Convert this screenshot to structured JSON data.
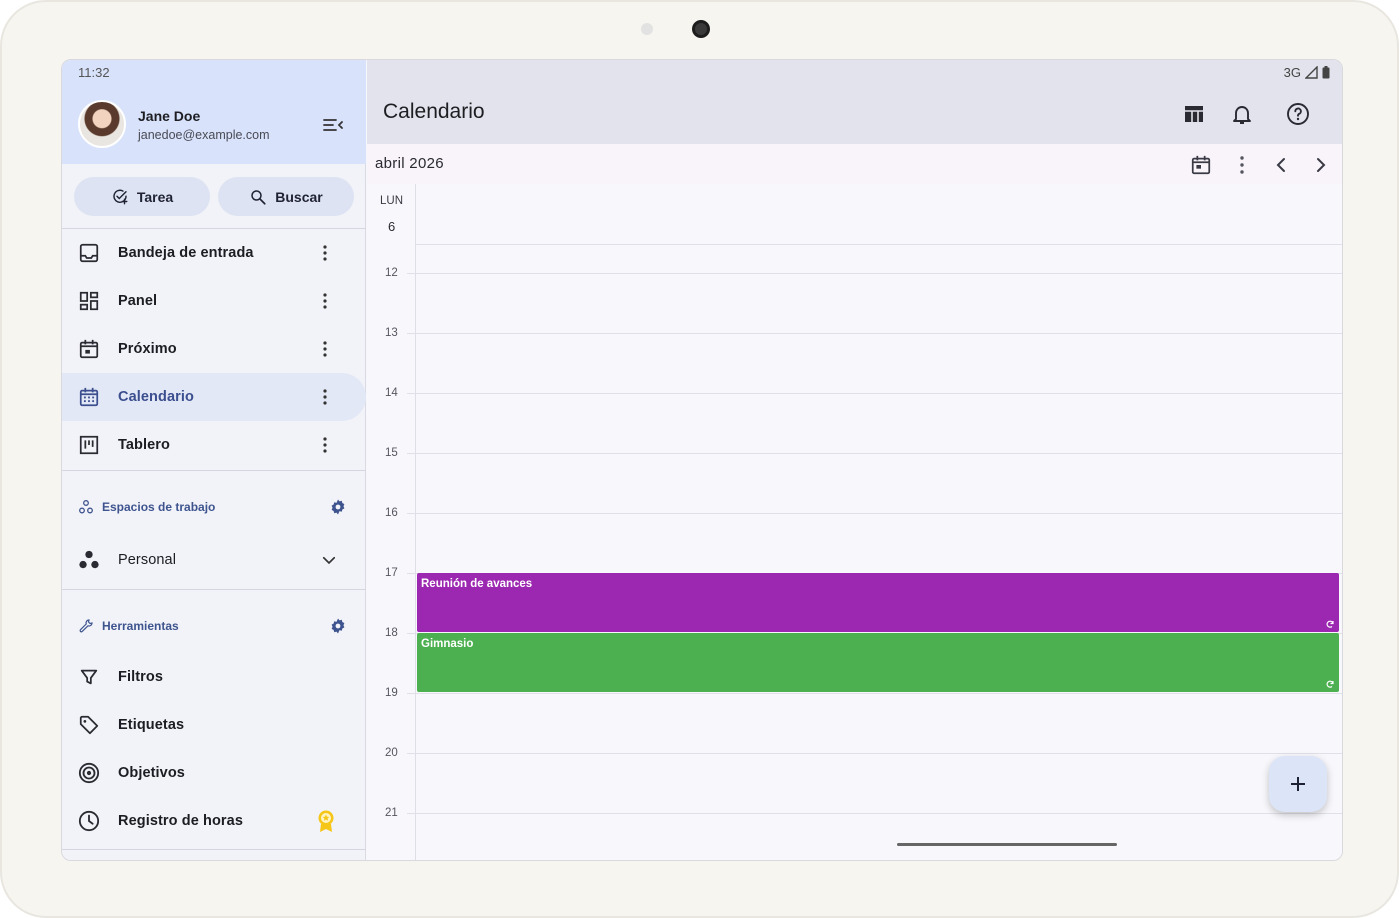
{
  "status": {
    "time": "11:32",
    "network": "3G"
  },
  "user": {
    "name": "Jane Doe",
    "email": "janedoe@example.com"
  },
  "actions": {
    "task_label": "Tarea",
    "search_label": "Buscar"
  },
  "nav": [
    {
      "label": "Bandeja de entrada",
      "icon": "inbox-icon"
    },
    {
      "label": "Panel",
      "icon": "dashboard-icon"
    },
    {
      "label": "Próximo",
      "icon": "upcoming-icon"
    },
    {
      "label": "Calendario",
      "icon": "calendar-icon",
      "active": true
    },
    {
      "label": "Tablero",
      "icon": "board-icon"
    }
  ],
  "workspaces": {
    "header": "Espacios de trabajo",
    "items": [
      {
        "label": "Personal"
      }
    ]
  },
  "tools": {
    "header": "Herramientas",
    "items": [
      {
        "label": "Filtros",
        "icon": "filter-icon"
      },
      {
        "label": "Etiquetas",
        "icon": "tag-icon"
      },
      {
        "label": "Objetivos",
        "icon": "target-icon"
      },
      {
        "label": "Registro de horas",
        "icon": "clock-icon",
        "badge": "premium-badge-icon"
      }
    ]
  },
  "main": {
    "title": "Calendario",
    "month": "abril 2026",
    "day_name": "LUN",
    "day_number": "6",
    "hours": [
      "12",
      "13",
      "14",
      "15",
      "16",
      "17",
      "18",
      "19",
      "20",
      "21"
    ],
    "events": [
      {
        "title": "Reunión de avances",
        "color": "#9c27b0",
        "start_hour": "17"
      },
      {
        "title": "Gimnasio",
        "color": "#4caf50",
        "start_hour": "18"
      }
    ]
  },
  "colors": {
    "accent": "#3b4f8f",
    "header_bg": "#d8e3fb",
    "premium": "#f5c518"
  }
}
